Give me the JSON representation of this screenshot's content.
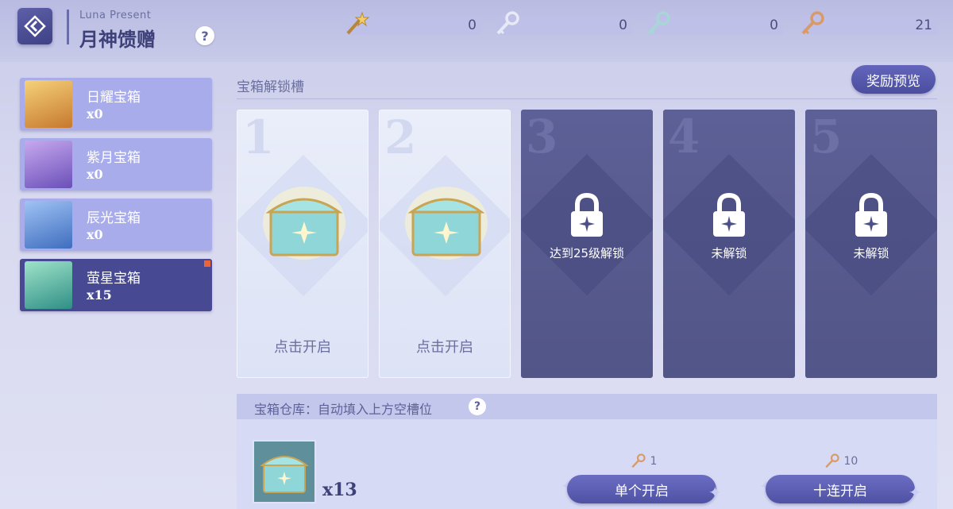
{
  "header": {
    "title_en": "Luna Present",
    "title_cn": "月神馈赠",
    "help_label": "?",
    "currencies": [
      {
        "icon": "gold-wand-icon",
        "value": "0"
      },
      {
        "icon": "silver-key-icon",
        "value": "0"
      },
      {
        "icon": "teal-key-icon",
        "value": "0"
      },
      {
        "icon": "bronze-key-icon",
        "value": "21"
      }
    ]
  },
  "sidebar": {
    "items": [
      {
        "name": "日耀宝箱",
        "count": "x0",
        "color": "#e2a44a"
      },
      {
        "name": "紫月宝箱",
        "count": "x0",
        "color": "#8a6fd0"
      },
      {
        "name": "辰光宝箱",
        "count": "x0",
        "color": "#4f7fd0"
      },
      {
        "name": "萤星宝箱",
        "count": "x15",
        "color": "#4fb4a4",
        "active": true
      }
    ]
  },
  "slots": {
    "label": "宝箱解锁槽",
    "preview_button": "奖励预览",
    "items": [
      {
        "number": "1",
        "state": "open",
        "text": "点击开启"
      },
      {
        "number": "2",
        "state": "open",
        "text": "点击开启"
      },
      {
        "number": "3",
        "state": "locked",
        "text": "达到25级解锁"
      },
      {
        "number": "4",
        "state": "locked",
        "text": "未解锁"
      },
      {
        "number": "5",
        "state": "locked",
        "text": "未解锁"
      }
    ]
  },
  "storage": {
    "label": "宝箱仓库：自动填入上方空槽位",
    "help_label": "?",
    "count": "x13",
    "single": {
      "cost": "1",
      "label": "单个开启"
    },
    "ten": {
      "cost": "10",
      "label": "十连开启"
    }
  }
}
